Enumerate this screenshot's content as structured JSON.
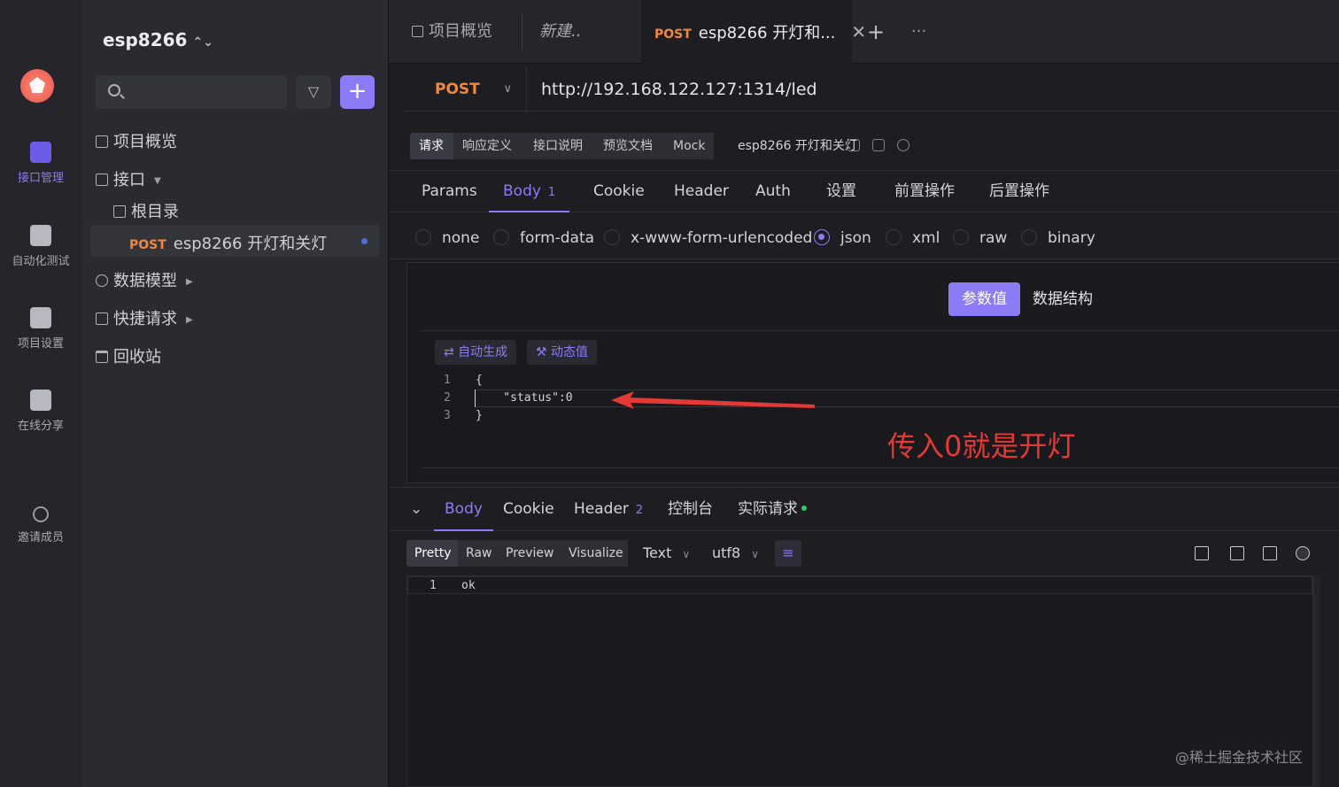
{
  "rail": {
    "items": [
      {
        "label": "接口管理",
        "icon": "api-management-icon",
        "active": true
      },
      {
        "label": "自动化测试",
        "icon": "automation-test-icon",
        "active": false
      },
      {
        "label": "项目设置",
        "icon": "project-settings-icon",
        "active": false
      },
      {
        "label": "在线分享",
        "icon": "online-share-icon",
        "active": false
      },
      {
        "label": "邀请成员",
        "icon": "invite-member-icon",
        "active": false
      }
    ]
  },
  "sidebar": {
    "project_name": "esp8266",
    "project_chevron": "⌃⌄",
    "filter_icon": "▽",
    "add_icon": "+",
    "items": {
      "overview": "项目概览",
      "api": "接口",
      "root": "根目录",
      "selected_method": "POST",
      "selected_name": "esp8266 开灯和关灯",
      "data_model": "数据模型",
      "quick_request": "快捷请求",
      "recycle_bin": "回收站"
    }
  },
  "tabs": {
    "overview": "项目概览",
    "new": "新建..",
    "active_method": "POST",
    "active_title": "esp8266 开灯和...",
    "close": "✕",
    "add": "+",
    "more": "···"
  },
  "request": {
    "method": "POST",
    "url": "http://192.168.122.127:1314/led",
    "subtabs": [
      "请求",
      "响应定义",
      "接口说明",
      "预览文档",
      "Mock"
    ],
    "title": "esp8266 开灯和关灯",
    "tabs": [
      "Params",
      "Body",
      "Cookie",
      "Header",
      "Auth",
      "设置",
      "前置操作",
      "后置操作"
    ],
    "body_count": "1",
    "body_types": [
      "none",
      "form-data",
      "x-www-form-urlencoded",
      "json",
      "xml",
      "raw",
      "binary"
    ],
    "selected_body_type": "json",
    "mode_on": "参数值",
    "mode_off": "数据结构",
    "tool_auto": "⇄ 自动生成",
    "tool_dynamic": "⚒ 动态值",
    "code_lines": [
      {
        "n": "1",
        "text": "{"
      },
      {
        "n": "2",
        "text": "    \"status\":0"
      },
      {
        "n": "3",
        "text": "}"
      }
    ],
    "annotation": "传入0就是开灯"
  },
  "response": {
    "collapse": "⌄",
    "tabs": [
      "Body",
      "Cookie",
      "Header",
      "控制台",
      "实际请求"
    ],
    "header_count": "2",
    "view_modes": [
      "Pretty",
      "Raw",
      "Preview",
      "Visualize"
    ],
    "format": "Text",
    "encoding": "utf8",
    "wrap_icon": "≡",
    "lines": [
      {
        "n": "1",
        "text": "ok"
      }
    ]
  },
  "watermark": "@稀土掘金技术社区",
  "colors": {
    "accent": "#8b7cf6",
    "post": "#f0883e",
    "annotation": "#e53935"
  }
}
